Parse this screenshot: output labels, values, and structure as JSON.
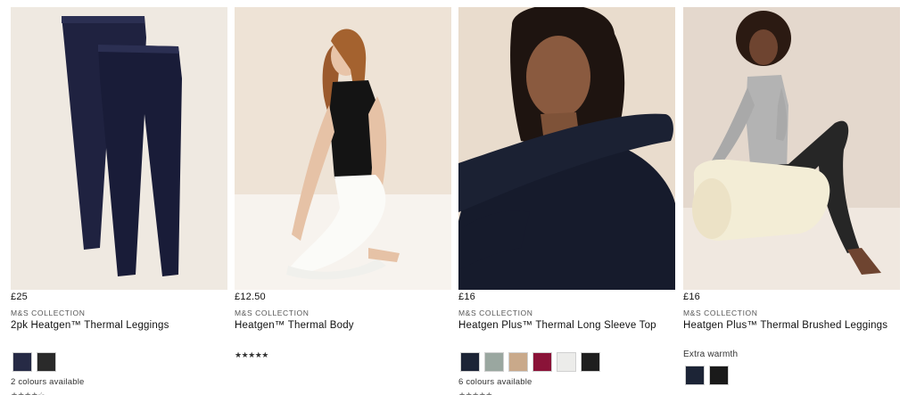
{
  "products": [
    {
      "price": "£25",
      "brand": "M&S COLLECTION",
      "name": "2pk Heatgen™ Thermal Leggings",
      "swatch_colors": [
        "#262a45",
        "#2a2a2a"
      ],
      "colours_label": "2 colours available",
      "rating_stars": "★★★★☆"
    },
    {
      "price": "£12.50",
      "brand": "M&S COLLECTION",
      "name": "Heatgen™ Thermal Body",
      "rating_stars": "★★★★★"
    },
    {
      "price": "£16",
      "brand": "M&S COLLECTION",
      "name": "Heatgen Plus™ Thermal Long Sleeve Top",
      "swatch_colors": [
        "#1c2436",
        "#9aa7a0",
        "#c9a98a",
        "#8a1338",
        "#ececea",
        "#1e1e1e"
      ],
      "colours_label": "6 colours available",
      "rating_stars": "★★★★★"
    },
    {
      "price": "£16",
      "brand": "M&S COLLECTION",
      "name": "Heatgen Plus™ Thermal Brushed Leggings",
      "extra_label": "Extra warmth",
      "swatch_colors": [
        "#1c2436",
        "#1a1a1a"
      ]
    }
  ]
}
